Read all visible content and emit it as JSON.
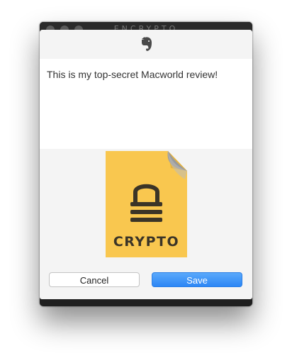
{
  "window": {
    "title": "ENCRYPTO"
  },
  "note": {
    "text": "This is my top-secret Macworld review!"
  },
  "file_icon": {
    "label": "CRYPTO",
    "color": "#f9c74f"
  },
  "buttons": {
    "cancel_label": "Cancel",
    "save_label": "Save"
  },
  "colors": {
    "accent": "#2c86f5"
  }
}
